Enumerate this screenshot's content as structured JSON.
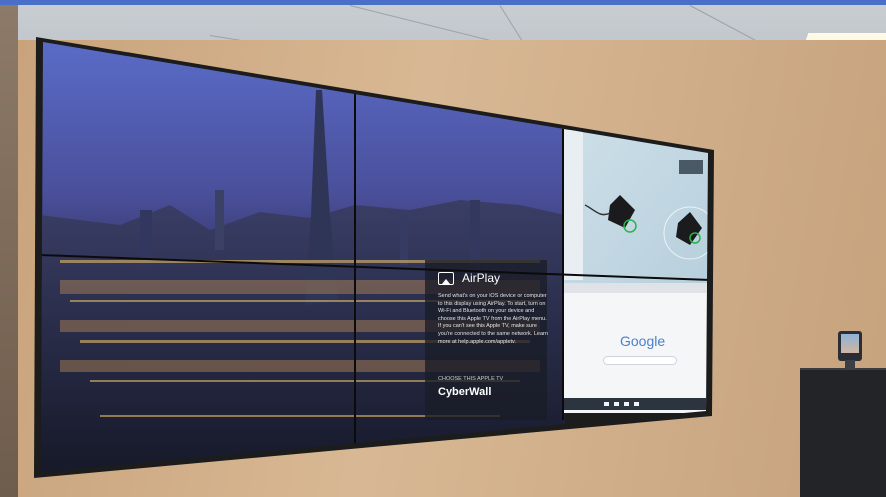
{
  "airplay": {
    "title": "AirPlay",
    "body": "Send what's on your iOS device or computer to this display using AirPlay. To start, turn on Wi-Fi and Bluetooth on your device and choose this Apple TV from the AirPlay menu. If you can't see this Apple TV, make sure you're connected to the same network. Learn more at help.apple.com/appletv.",
    "choose_label": "CHOOSE THIS APPLE TV",
    "device_name": "CyberWall"
  },
  "browser": {
    "search_logo": "Google"
  },
  "colors": {
    "top_bar": "#4a6fc9",
    "wall": "#d2b28c",
    "ceiling": "#c1c6cb"
  }
}
